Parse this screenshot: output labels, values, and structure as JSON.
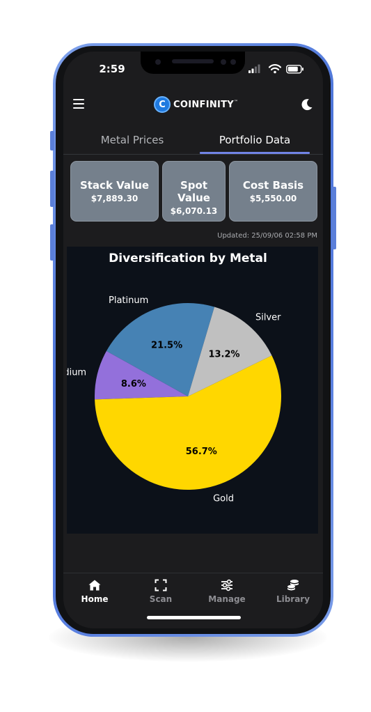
{
  "status_bar": {
    "time": "2:59"
  },
  "header": {
    "brand": "COINFINITY",
    "brand_tm": "™"
  },
  "tabs": [
    {
      "label": "Metal Prices",
      "active": false
    },
    {
      "label": "Portfolio Data",
      "active": true
    }
  ],
  "summary_cards": [
    {
      "title": "Stack Value",
      "value": "$7,889.30"
    },
    {
      "title": "Spot Value",
      "value": "$6,070.13"
    },
    {
      "title": "Cost Basis",
      "value": "$5,550.00"
    }
  ],
  "updated_text": "Updated: 25/09/06 02:58 PM",
  "chart_data": {
    "type": "pie",
    "title": "Diversification by Metal",
    "slices": [
      {
        "label": "Platinum",
        "value": 21.5,
        "display": "21.5%",
        "color": "#4682B4"
      },
      {
        "label": "Palladium",
        "value": 8.6,
        "display": "8.6%",
        "color": "#9370DB"
      },
      {
        "label": "Gold",
        "value": 56.7,
        "display": "56.7%",
        "color": "#FFD700"
      },
      {
        "label": "Silver",
        "value": 13.2,
        "display": "13.2%",
        "color": "#C0C0C0"
      }
    ],
    "start_angle_deg": 73.5,
    "direction": "counterclockwise",
    "background": "#0c1119"
  },
  "bottom_nav": [
    {
      "label": "Home",
      "icon": "home-icon",
      "active": true
    },
    {
      "label": "Scan",
      "icon": "scan-icon",
      "active": false
    },
    {
      "label": "Manage",
      "icon": "sliders-icon",
      "active": false
    },
    {
      "label": "Library",
      "icon": "coins-stack-icon",
      "active": false
    }
  ],
  "colors": {
    "frame_accent": "#4c74d8",
    "tab_underline": "#7184e6",
    "card_bg": "#75808c",
    "nav_active": "#ffffff",
    "nav_inactive": "#8e8e93"
  }
}
